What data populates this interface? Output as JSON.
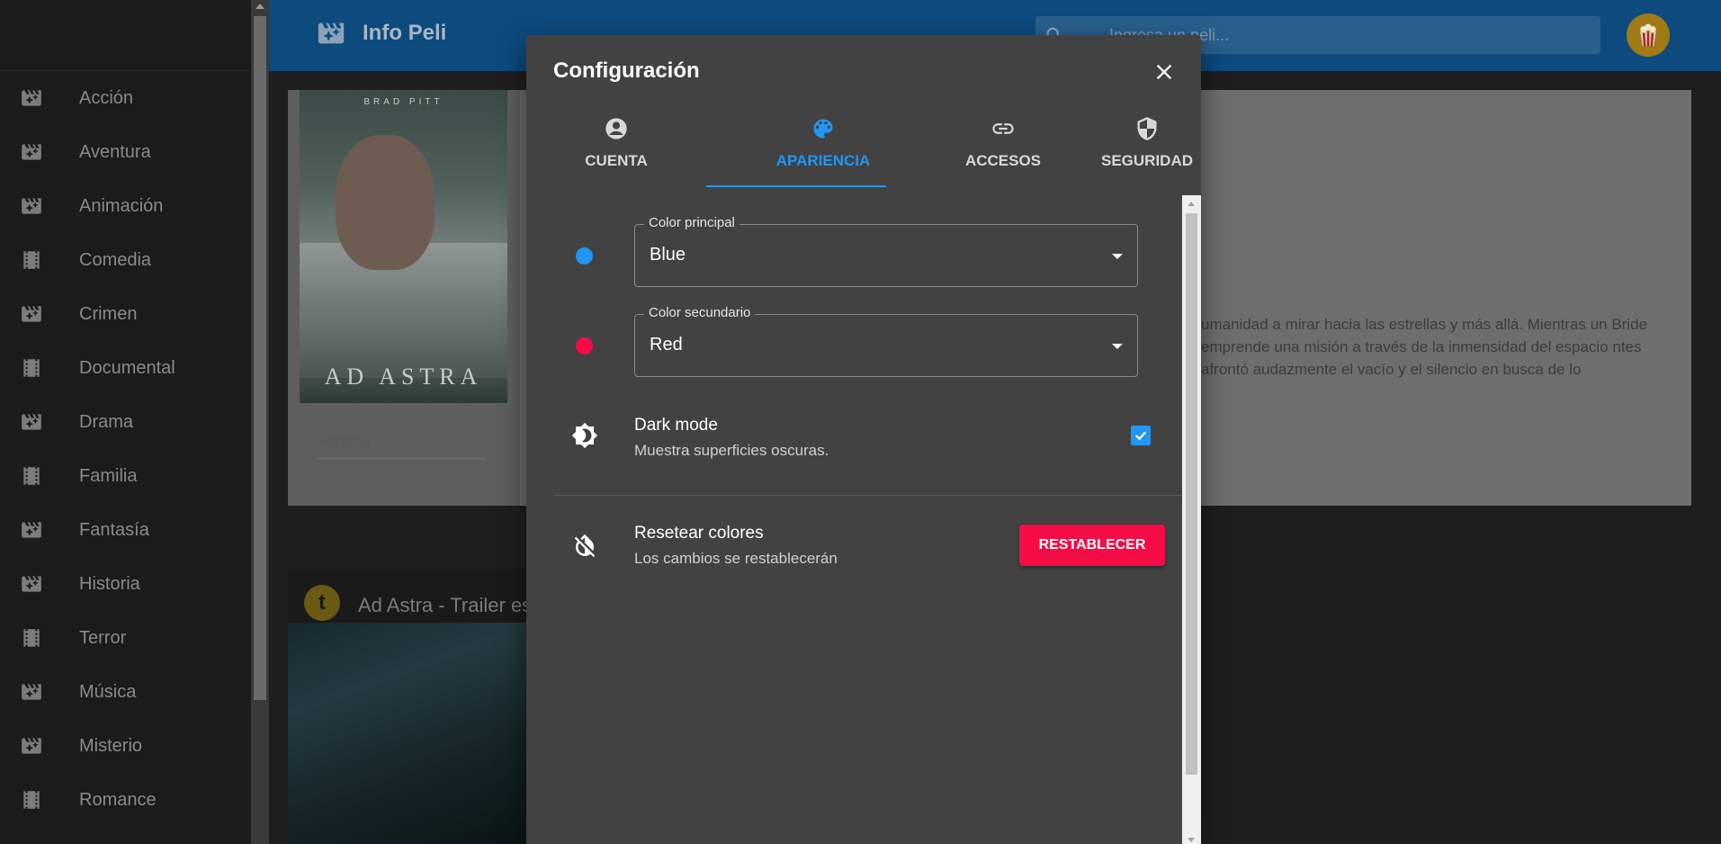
{
  "app": {
    "title": "Info Peli"
  },
  "search": {
    "placeholder": "Ingresa un peli..."
  },
  "sidebar": {
    "items": [
      {
        "label": "Acción",
        "icon": "movie-icon"
      },
      {
        "label": "Aventura",
        "icon": "movie-icon"
      },
      {
        "label": "Animación",
        "icon": "movie-icon"
      },
      {
        "label": "Comedia",
        "icon": "film-strip-icon"
      },
      {
        "label": "Crimen",
        "icon": "movie-icon"
      },
      {
        "label": "Documental",
        "icon": "film-strip-icon"
      },
      {
        "label": "Drama",
        "icon": "movie-icon"
      },
      {
        "label": "Familia",
        "icon": "film-strip-icon"
      },
      {
        "label": "Fantasía",
        "icon": "movie-icon"
      },
      {
        "label": "Historia",
        "icon": "movie-icon"
      },
      {
        "label": "Terror",
        "icon": "film-strip-icon"
      },
      {
        "label": "Música",
        "icon": "movie-icon"
      },
      {
        "label": "Misterio",
        "icon": "movie-icon"
      },
      {
        "label": "Romance",
        "icon": "film-strip-icon"
      }
    ]
  },
  "background": {
    "poster_name": "BRAD PITT",
    "poster_title": "AD ASTRA",
    "add_select_placeholder": "Agregar a",
    "synopsis": "umanidad a mirar hacia las estrellas y más allá. Mientras un Bride emprende una misión a través de la inmensidad del espacio ntes afrontó audazmente el vacío y el silencio en busca de lo",
    "video_title": "Ad Astra - Trailer es",
    "video_logo": "t"
  },
  "dialog": {
    "title": "Configuración",
    "tabs": [
      {
        "label": "CUENTA",
        "icon": "account-circle-icon",
        "active": false
      },
      {
        "label": "APARIENCIA",
        "icon": "palette-icon",
        "active": true
      },
      {
        "label": "ACCESOS",
        "icon": "link-icon",
        "active": false
      },
      {
        "label": "SEGURIDAD",
        "icon": "shield-icon",
        "active": false
      }
    ],
    "primary_color": {
      "label": "Color principal",
      "value": "Blue",
      "swatch": "#2196f3"
    },
    "secondary_color": {
      "label": "Color secundario",
      "value": "Red",
      "swatch": "#f50c47"
    },
    "dark_mode": {
      "title": "Dark mode",
      "subtitle": "Muestra superficies oscuras.",
      "checked": true
    },
    "reset": {
      "title": "Resetear colores",
      "subtitle": "Los cambios se restablecerán",
      "button": "RESTABLECER"
    }
  },
  "colors": {
    "accent": "#2196f3",
    "danger": "#f50c47",
    "header": "#0d4a7e",
    "dialog_bg": "#424242"
  }
}
